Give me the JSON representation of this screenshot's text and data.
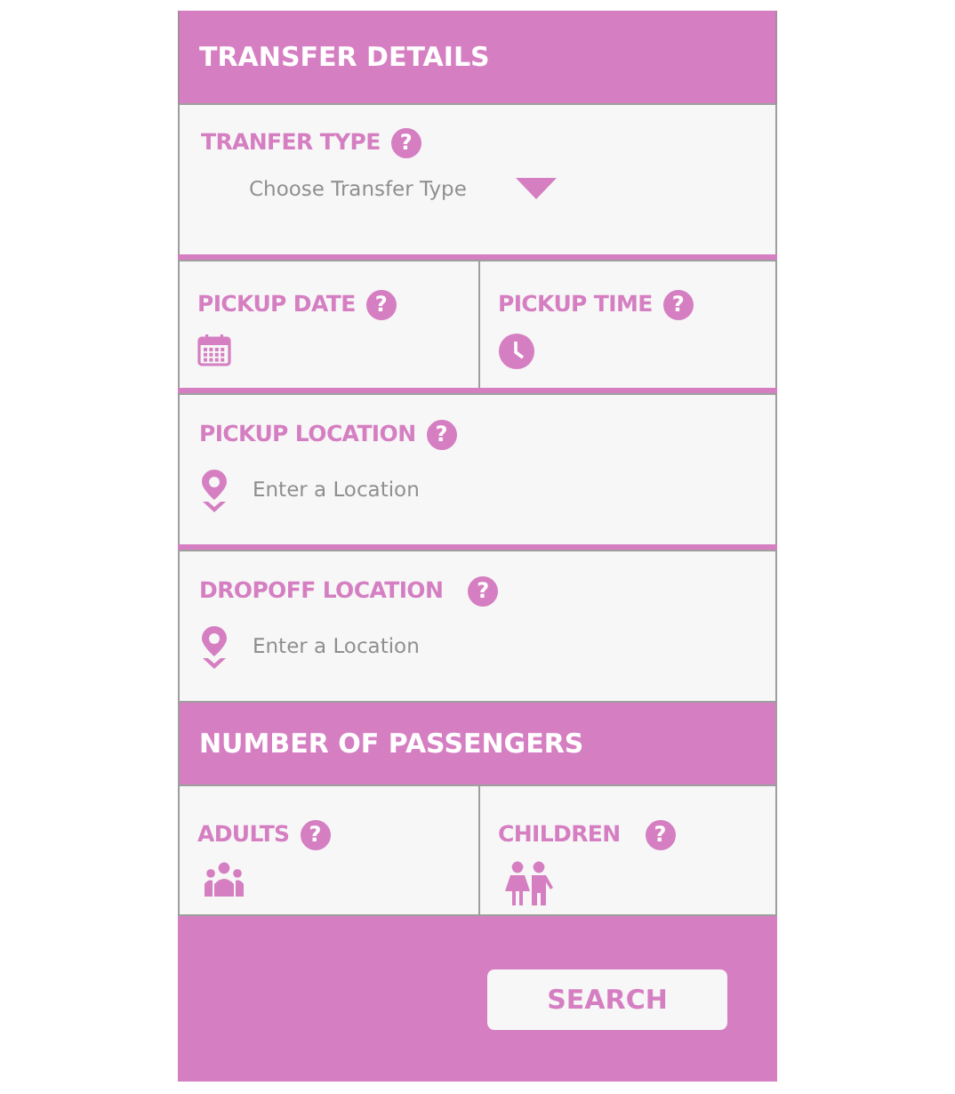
{
  "header": {
    "title": "TRANSFER DETAILS"
  },
  "transfer_type": {
    "label": "TRANFER TYPE",
    "help": "?",
    "placeholder": "Choose Transfer Type"
  },
  "pickup_row": [
    {
      "label": "PICKUP DATE",
      "help": "?",
      "kind": "date"
    },
    {
      "label": "PICKUP TIME",
      "help": "?",
      "kind": "time"
    }
  ],
  "locations": [
    {
      "label": "PICKUP LOCATION",
      "help": "?",
      "placeholder": "Enter a Location"
    },
    {
      "label": "DROPOFF LOCATION",
      "help": "?",
      "placeholder": "Enter a Location"
    }
  ],
  "passengers_header": {
    "title": "NUMBER OF PASSENGERS"
  },
  "passengers": [
    {
      "label": "ADULTS",
      "help": "?",
      "kind": "adults"
    },
    {
      "label": "CHILDREN",
      "help": "?",
      "kind": "children"
    }
  ],
  "search_button": "SEARCH"
}
